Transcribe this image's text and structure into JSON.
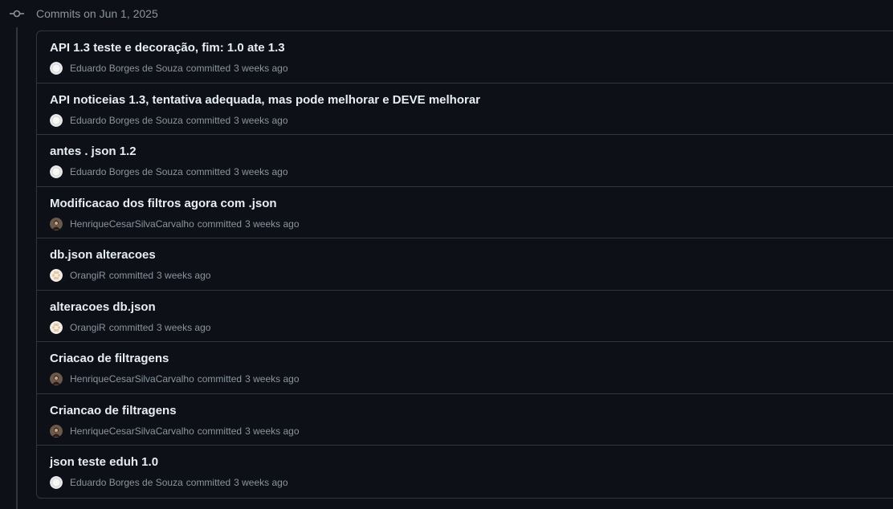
{
  "group": {
    "title": "Commits on Jun 1, 2025"
  },
  "commits": [
    {
      "title": "API 1.3 teste e decoração, fim: 1.0 ate 1.3",
      "author": "Eduardo Borges de Souza",
      "action": "committed",
      "time": "3 weeks ago",
      "avatar": "white-avatar-icon"
    },
    {
      "title": "API noticeias 1.3, tentativa adequada, mas pode melhorar e DEVE melhorar",
      "author": "Eduardo Borges de Souza",
      "action": "committed",
      "time": "3 weeks ago",
      "avatar": "white-avatar-icon"
    },
    {
      "title": "antes . json 1.2",
      "author": "Eduardo Borges de Souza",
      "action": "committed",
      "time": "3 weeks ago",
      "avatar": "white-avatar-icon"
    },
    {
      "title": "Modificacao dos filtros agora com .json",
      "author": "HenriqueCesarSilvaCarvalho",
      "action": "committed",
      "time": "3 weeks ago",
      "avatar": "photo-avatar-icon"
    },
    {
      "title": "db.json alteracoes",
      "author": "OrangiR",
      "action": "committed",
      "time": "3 weeks ago",
      "avatar": "identicon-avatar-icon"
    },
    {
      "title": "alteracoes db.json",
      "author": "OrangiR",
      "action": "committed",
      "time": "3 weeks ago",
      "avatar": "identicon-avatar-icon"
    },
    {
      "title": "Criacao de filtragens",
      "author": "HenriqueCesarSilvaCarvalho",
      "action": "committed",
      "time": "3 weeks ago",
      "avatar": "photo-avatar-icon"
    },
    {
      "title": "Criancao de filtragens",
      "author": "HenriqueCesarSilvaCarvalho",
      "action": "committed",
      "time": "3 weeks ago",
      "avatar": "photo-avatar-icon"
    },
    {
      "title": "json teste eduh 1.0",
      "author": "Eduardo Borges de Souza",
      "action": "committed",
      "time": "3 weeks ago",
      "avatar": "white-avatar-icon"
    }
  ],
  "colors": {
    "background": "#0d1117",
    "border": "#30363d",
    "text_primary": "#e6edf3",
    "text_muted": "#8b949e"
  }
}
